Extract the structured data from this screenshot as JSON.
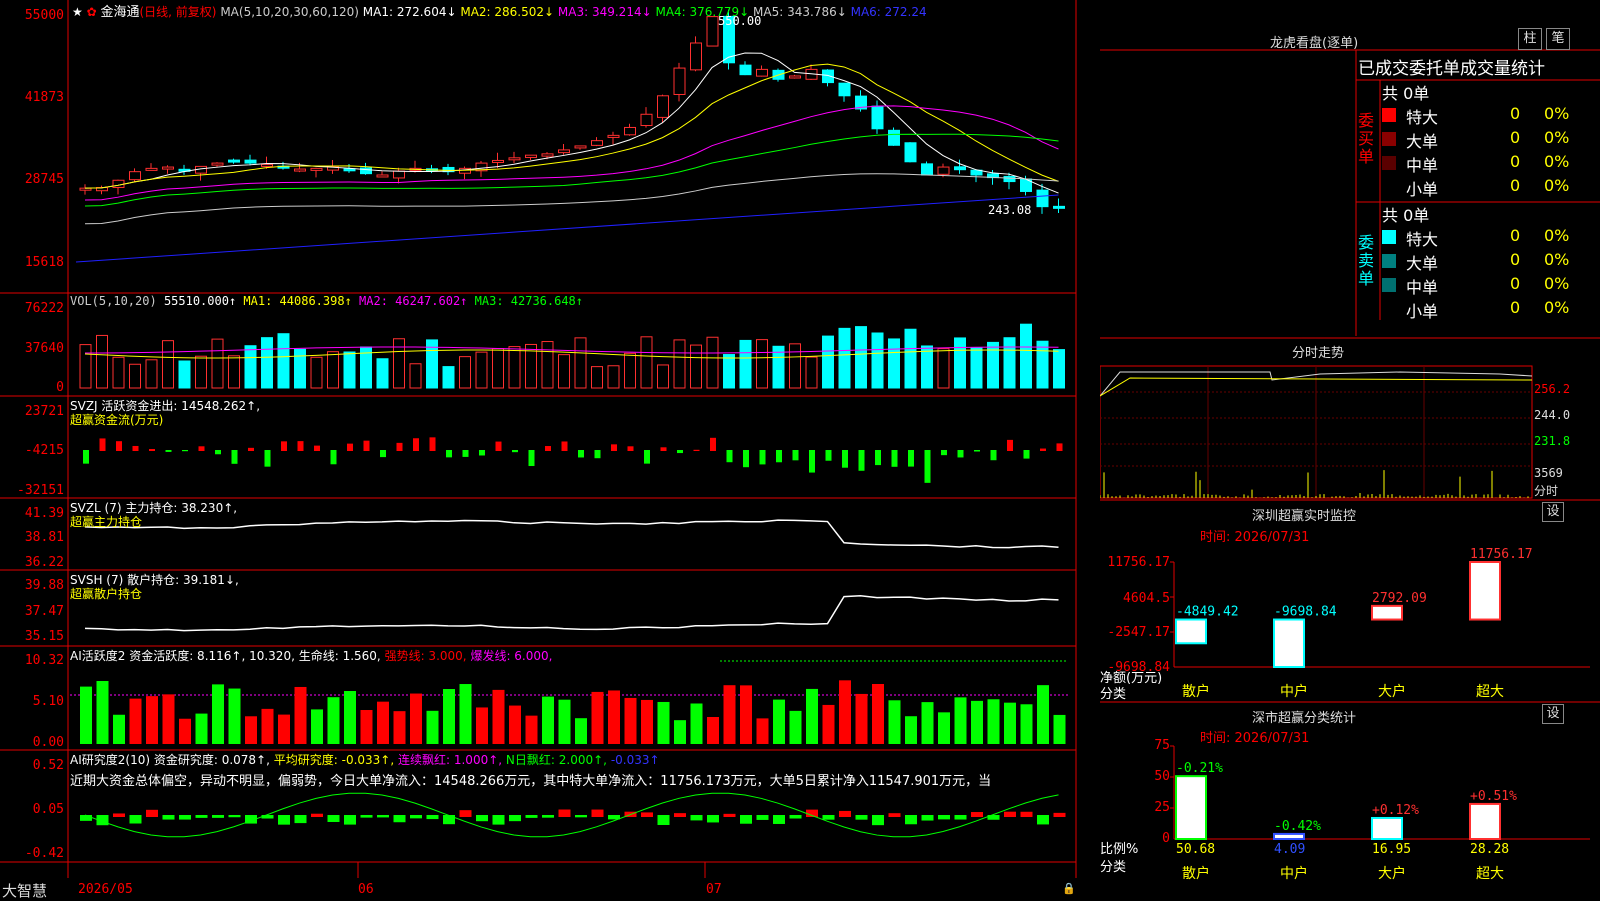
{
  "header": {
    "stock_name": "金海通",
    "period": "(日线, 前复权)",
    "ma_label": "MA(5,10,20,30,60,120)",
    "ma1": "MA1: 272.604↓",
    "ma2": "MA2: 286.502↓",
    "ma3": "MA3: 349.214↓",
    "ma4": "MA4: 376.779↓",
    "ma5": "MA5: 343.786↓",
    "ma6": "MA6: 272.24",
    "high_marker": "550.00",
    "low_marker": "243.08"
  },
  "axes": {
    "price": [
      "55000",
      "41873",
      "28745",
      "15618"
    ],
    "vol": [
      "76222",
      "37640",
      "0"
    ],
    "svzj": [
      "23721",
      "-4215",
      "-32151"
    ],
    "svzl": [
      "41.39",
      "38.81",
      "36.22"
    ],
    "svsh": [
      "39.88",
      "37.47",
      "35.15"
    ],
    "ai1": [
      "10.32",
      "5.10",
      "0.00"
    ],
    "ai2": [
      "0.52",
      "0.05",
      "-0.42"
    ]
  },
  "panels": {
    "vol_label": "VOL(5,10,20)",
    "vol_value": "55510.000↑",
    "vol_ma1": "MA1: 44086.398↑",
    "vol_ma2": "MA2: 46247.602↑",
    "vol_ma3": "MA3: 42736.648↑",
    "svzj_label": "SVZJ  活跃资金进出: 14548.262↑,",
    "svzj_sub": "超赢资金流(万元)",
    "svzl_label": "SVZL (7) 主力持仓: 38.230↑,",
    "svzl_sub": "超赢主力持仓",
    "svsh_label": "SVSH (7) 散户持仓: 39.181↓,",
    "svsh_sub": "超赢散户持仓",
    "ai1_label": "AI活跃度2 资金活跃度: 8.116↑, 10.320, 生命线: 1.560,",
    "ai1_strong": "强势线: 3.000,",
    "ai1_burst": "爆发线: 6.000,",
    "ai2_label": "AI研究度2(10) 资金研究度: 0.078↑,",
    "ai2_avg": "平均研究度: -0.033↑,",
    "ai2_red": "连续飘红: 1.000↑,",
    "ai2_nred": "N日飘红: 2.000↑,",
    "ai2_last": "-0.033↑",
    "ai2_text": "近期大资金总体偏空，异动不明显，偏弱势，今日大单净流入：14548.266万元，其中特大单净流入：11756.173万元，大单5日累计净入11547.901万元，当"
  },
  "bottom_bar": {
    "brand": "大智慧",
    "dates": [
      "2026/05",
      "06",
      "07"
    ]
  },
  "right_panel": {
    "dragon_title": "龙虎看盘(逐单)",
    "btn_bar": "柱",
    "btn_pen": "笔",
    "order_header": "已成交委托单成交量统计",
    "buy": {
      "side_label": "委买单",
      "total": "共 0单",
      "rows": [
        {
          "name": "特大",
          "count": "0",
          "pct": "0%",
          "color": "#ff0000"
        },
        {
          "name": "大单",
          "count": "0",
          "pct": "0%",
          "color": "#8b0000"
        },
        {
          "name": "中单",
          "count": "0",
          "pct": "0%",
          "color": "#5a0000"
        },
        {
          "name": "小单",
          "count": "0",
          "pct": "0%",
          "color": ""
        }
      ]
    },
    "sell": {
      "side_label": "委卖单",
      "total": "共 0单",
      "rows": [
        {
          "name": "特大",
          "count": "0",
          "pct": "0%",
          "color": "#00ffff"
        },
        {
          "name": "大单",
          "count": "0",
          "pct": "0%",
          "color": "#008080"
        },
        {
          "name": "中单",
          "count": "0",
          "pct": "0%",
          "color": "#007070"
        },
        {
          "name": "小单",
          "count": "0",
          "pct": "0%",
          "color": ""
        }
      ]
    },
    "intraday_title": "分时走势",
    "intraday_axis": [
      "256.2",
      "244.0",
      "231.8",
      "3569",
      "分时"
    ],
    "sz_monitor_title": "深圳超赢实时监控",
    "sz_monitor_btn": "设",
    "sz_monitor_time": "时间: 2026/07/31",
    "monitor_axis": [
      "11756.17",
      "4604.5",
      "-2547.17",
      "-9698.84"
    ],
    "monitor_ylabel": "净额(万元)",
    "monitor_xlabel": "分类",
    "monitor_bars": [
      {
        "name": "散户",
        "value": -4849.42,
        "label": "-4849.42"
      },
      {
        "name": "中户",
        "value": -9698.84,
        "label": "-9698.84"
      },
      {
        "name": "大户",
        "value": 2792.09,
        "label": "2792.09"
      },
      {
        "name": "超大",
        "value": 11756.17,
        "label": "11756.17"
      }
    ],
    "sz_stat_title": "深市超赢分类统计",
    "sz_stat_btn": "设",
    "sz_stat_time": "时间: 2026/07/31",
    "stat_axis": [
      "75",
      "50",
      "25",
      "0"
    ],
    "stat_ylabel": "比例%",
    "stat_xlabel": "分类",
    "stat_bars": [
      {
        "name": "散户",
        "value": 50.68,
        "label": "50.68",
        "change": "-0.21%"
      },
      {
        "name": "中户",
        "value": 4.09,
        "label": "4.09",
        "change": "-0.42%"
      },
      {
        "name": "大户",
        "value": 16.95,
        "label": "16.95",
        "change": "+0.12%"
      },
      {
        "name": "超大",
        "value": 28.28,
        "label": "28.28",
        "change": "+0.51%"
      }
    ]
  },
  "chart_data": [
    {
      "type": "candlestick",
      "title": "金海通 (日线, 前复权)",
      "ylim": [
        15618,
        55000
      ],
      "high": 550.0,
      "low": 243.08,
      "x_ticks": [
        "2026/05",
        "06",
        "07"
      ]
    },
    {
      "type": "bar",
      "title": "VOL(5,10,20)",
      "ylim": [
        0,
        76222
      ]
    },
    {
      "type": "bar",
      "title": "SVZJ 活跃资金进出",
      "ylim": [
        -32151,
        23721
      ]
    },
    {
      "type": "line",
      "title": "SVZL (7) 主力持仓",
      "ylim": [
        36.22,
        41.39
      ]
    },
    {
      "type": "line",
      "title": "SVSH (7) 散户持仓",
      "ylim": [
        35.15,
        39.88
      ]
    },
    {
      "type": "bar",
      "title": "AI活跃度2",
      "ylim": [
        0,
        10.32
      ]
    },
    {
      "type": "bar",
      "title": "AI研究度2(10)",
      "ylim": [
        -0.42,
        0.52
      ]
    },
    {
      "type": "bar",
      "title": "深圳超赢实时监控",
      "categories": [
        "散户",
        "中户",
        "大户",
        "超大"
      ],
      "values": [
        -4849.42,
        -9698.84,
        2792.09,
        11756.17
      ],
      "ylim": [
        -9698.84,
        11756.17
      ],
      "ylabel": "净额(万元)",
      "xlabel": "分类"
    },
    {
      "type": "bar",
      "title": "深市超赢分类统计",
      "categories": [
        "散户",
        "中户",
        "大户",
        "超大"
      ],
      "values": [
        50.68,
        4.09,
        16.95,
        28.28
      ],
      "ylim": [
        0,
        75
      ],
      "ylabel": "比例%",
      "xlabel": "分类"
    }
  ]
}
